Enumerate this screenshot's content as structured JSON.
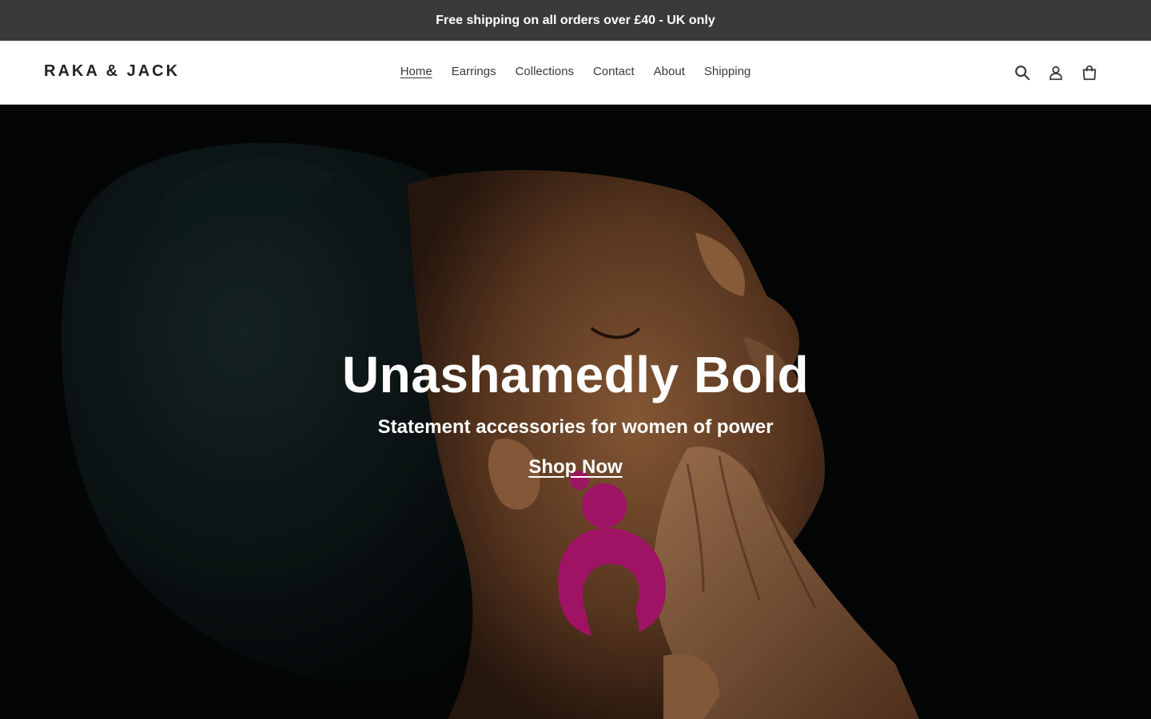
{
  "announcement": {
    "text": "Free shipping on all orders over £40 - UK only"
  },
  "header": {
    "logo": "RAKA & JACK",
    "nav": [
      {
        "label": "Home",
        "active": true
      },
      {
        "label": "Earrings",
        "active": false
      },
      {
        "label": "Collections",
        "active": false
      },
      {
        "label": "Contact",
        "active": false
      },
      {
        "label": "About",
        "active": false
      },
      {
        "label": "Shipping",
        "active": false
      }
    ],
    "icons": [
      "search-icon",
      "account-icon",
      "cart-icon"
    ]
  },
  "hero": {
    "title": "Unashamedly Bold",
    "subtitle": "Statement accessories for women of power",
    "cta": "Shop Now",
    "image": "woman-in-black-headwrap-with-magenta-earring"
  },
  "colors": {
    "announcement_bg": "#3a3a3a",
    "header_bg": "#ffffff",
    "text": "#3a3a3a",
    "earring": "#c2187a"
  }
}
